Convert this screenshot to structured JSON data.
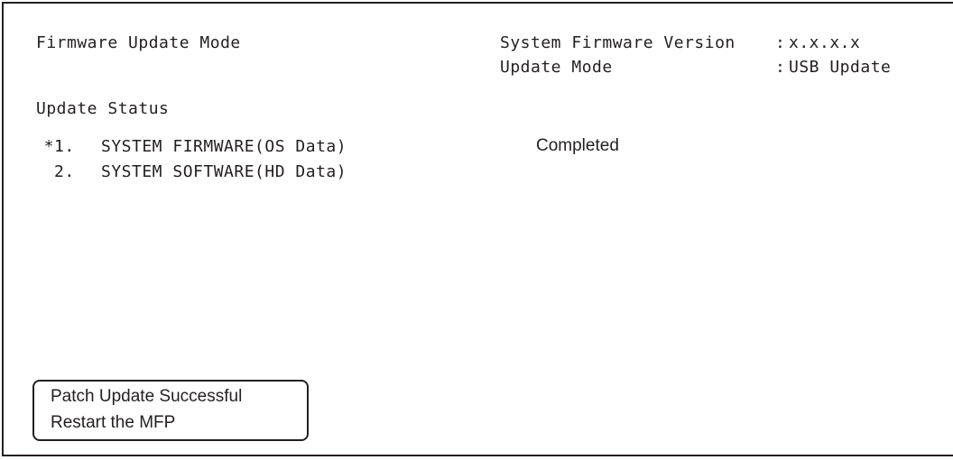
{
  "header": {
    "title": "Firmware Update Mode",
    "info": [
      {
        "label": "System Firmware Version",
        "separator": ":",
        "value": "x.x.x.x"
      },
      {
        "label": "Update Mode",
        "separator": ":",
        "value": "USB Update"
      }
    ]
  },
  "update_status": {
    "heading": "Update Status",
    "items": [
      {
        "marker": "*",
        "number": "1.",
        "name": "SYSTEM FIRMWARE(OS Data)",
        "status": "Completed"
      },
      {
        "marker": "",
        "number": "2.",
        "name": "SYSTEM SOFTWARE(HD Data)",
        "status": ""
      }
    ]
  },
  "message": {
    "line1": "Patch Update Successful",
    "line2": "Restart the MFP"
  }
}
